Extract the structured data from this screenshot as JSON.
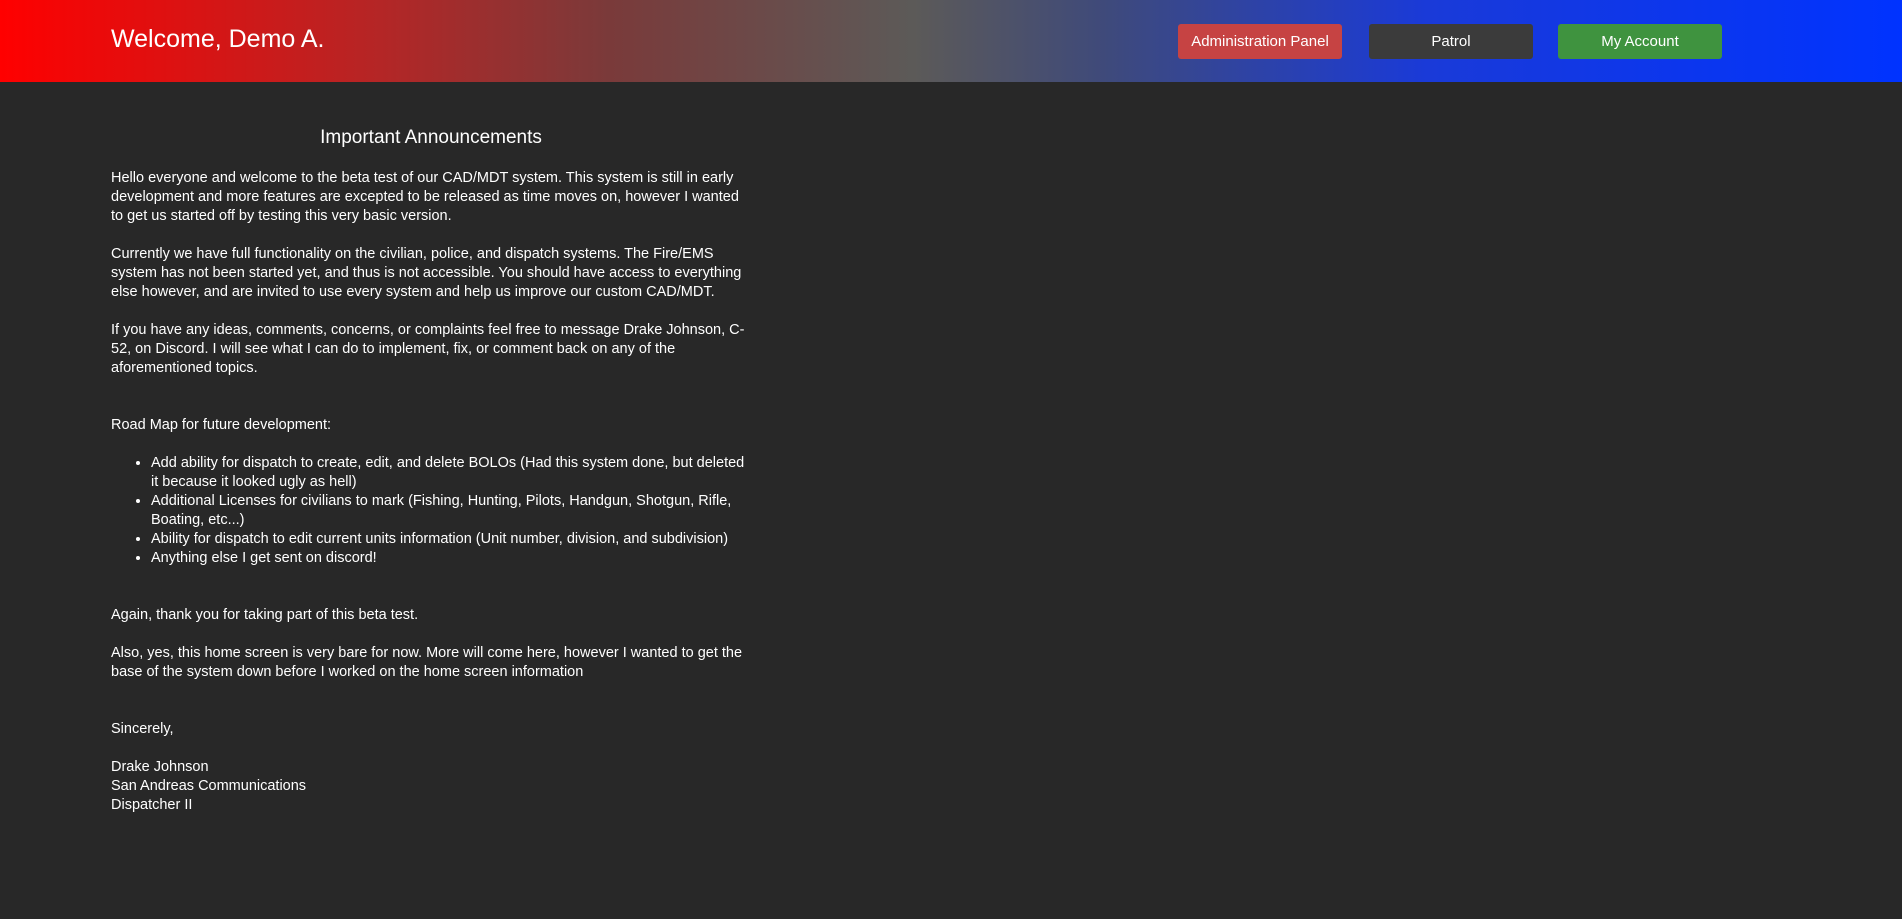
{
  "header": {
    "welcome": "Welcome, Demo A.",
    "buttons": {
      "admin": "Administration Panel",
      "patrol": "Patrol",
      "account": "My Account"
    }
  },
  "announcements": {
    "title": "Important Announcements",
    "paragraphs": [
      "Hello everyone and welcome to the beta test of our CAD/MDT system. This system is still in early development and more features are excepted to be released as time moves on, however I wanted to get us started off by testing this very basic version.",
      "Currently we have full functionality on the civilian, police, and dispatch systems. The Fire/EMS system has not been started yet, and thus is not accessible. You should have access to everything else however, and are invited to use every system and help us improve our custom CAD/MDT.",
      "If you have any ideas, comments, concerns, or complaints feel free to message Drake Johnson, C-52, on Discord. I will see what I can do to implement, fix, or comment back on any of the aforementioned topics."
    ],
    "roadmap_title": "Road Map for future development:",
    "roadmap_items": [
      "Add ability for dispatch to create, edit, and delete BOLOs (Had this system done, but deleted it because it looked ugly as hell)",
      "Additional Licenses for civilians to mark (Fishing, Hunting, Pilots, Handgun, Shotgun, Rifle, Boating, etc...)",
      "Ability for dispatch to edit current units information (Unit number, division, and subdivision)",
      "Anything else I get sent on discord!"
    ],
    "closing": [
      "Again, thank you for taking part of this beta test.",
      "Also, yes, this home screen is very bare for now. More will come here, however I wanted to get the base of the system down before I worked on the home screen information"
    ],
    "sign_off": "Sincerely,",
    "signature": {
      "name": "Drake Johnson",
      "org": "San Andreas Communications",
      "role": "Dispatcher II"
    }
  }
}
